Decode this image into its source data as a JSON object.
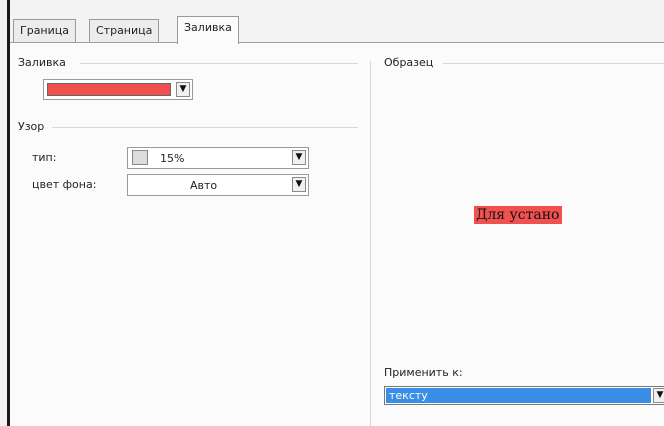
{
  "tabs": [
    {
      "label": "Граница",
      "active": false
    },
    {
      "label": "Страница",
      "active": false
    },
    {
      "label": "Заливка",
      "active": true
    }
  ],
  "fill_section": {
    "title": "Заливка",
    "color_hex": "#f05050"
  },
  "pattern_section": {
    "title": "Узор",
    "type_label": "тип:",
    "type_value": "15%",
    "bg_color_label": "цвет фона:",
    "bg_color_value": "Авто"
  },
  "preview_section": {
    "title": "Образец",
    "preview_text": "Для устано",
    "highlight_hex": "#f05050",
    "apply_label": "Применить к:",
    "apply_value": "тексту"
  },
  "colors": {
    "selection_blue": "#3b8ee8"
  }
}
